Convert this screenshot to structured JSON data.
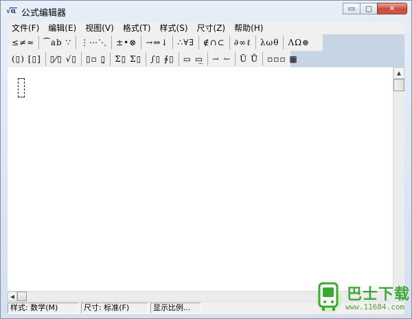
{
  "window": {
    "title": "公式编辑器",
    "icon_text": "√α",
    "controls": {
      "minimize": "▭",
      "maximize": "▢",
      "close": "✕"
    }
  },
  "menu": {
    "items": [
      {
        "label": "文件(F)"
      },
      {
        "label": "编辑(E)"
      },
      {
        "label": "视图(V)"
      },
      {
        "label": "格式(T)"
      },
      {
        "label": "样式(S)"
      },
      {
        "label": "尺寸(Z)"
      },
      {
        "label": "帮助(H)"
      }
    ]
  },
  "toolbar": {
    "row1": [
      {
        "label": "≤≠≈"
      },
      {
        "label": "⁀ab ∵"
      },
      {
        "label": "⋮⋯⋱"
      },
      {
        "label": "±•⊗"
      },
      {
        "label": "→⇔↓"
      },
      {
        "label": "∴∀∃"
      },
      {
        "label": "∉∩⊂"
      },
      {
        "label": "∂∞ℓ"
      },
      {
        "label": "λωθ"
      },
      {
        "label": "ΛΩ⊛"
      }
    ],
    "row2": [
      {
        "label": "(▯) [▯]"
      },
      {
        "label": "▯⁄▯ √▯"
      },
      {
        "label": "▯▫ ▯̰"
      },
      {
        "label": "Σ▯ Σ▯"
      },
      {
        "label": "∫▯ ∮▯"
      },
      {
        "label": "▭ ▭̲"
      },
      {
        "label": "⇀ ↼"
      },
      {
        "label": "Ū Ů"
      },
      {
        "label": "▫▫▫ ▦"
      }
    ]
  },
  "status": {
    "style": "样式: 数学(M)",
    "size": "尺寸: 标准(F)",
    "zoom": "显示比例..."
  },
  "watermark": {
    "title": "巴士下载",
    "url": "www.11684.com"
  },
  "colors": {
    "window_frame": "#d5e0ee",
    "toolbar_bg": "#f0f0f0",
    "toolbar_area_bg": "#c6d4e4",
    "close_button": "#c9483a",
    "watermark_green": "#3aa835"
  }
}
